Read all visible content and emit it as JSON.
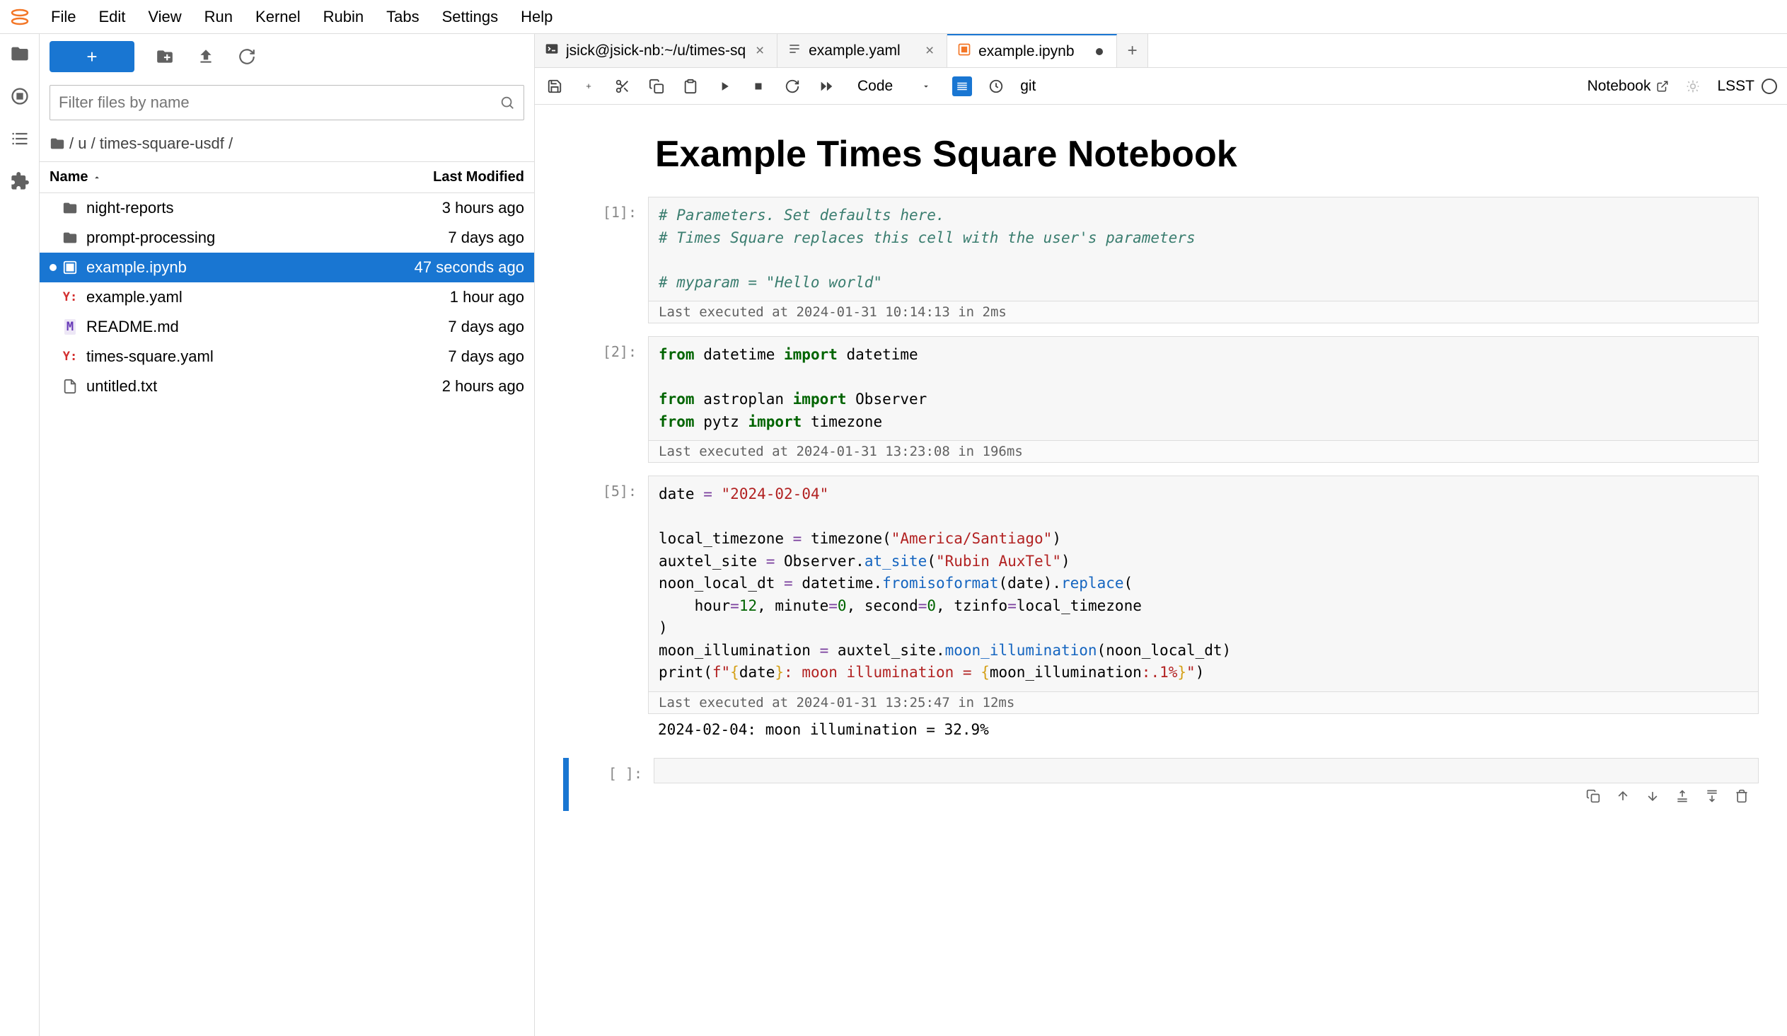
{
  "menu": [
    "File",
    "Edit",
    "View",
    "Run",
    "Kernel",
    "Rubin",
    "Tabs",
    "Settings",
    "Help"
  ],
  "filter_placeholder": "Filter files by name",
  "breadcrumb": "/ u / times-square-usdf /",
  "file_header": {
    "name": "Name",
    "modified": "Last Modified"
  },
  "files": [
    {
      "name": "night-reports",
      "type": "folder",
      "modified": "3 hours ago"
    },
    {
      "name": "prompt-processing",
      "type": "folder",
      "modified": "7 days ago"
    },
    {
      "name": "example.ipynb",
      "type": "notebook",
      "modified": "47 seconds ago",
      "selected": true,
      "dirty": true
    },
    {
      "name": "example.yaml",
      "type": "yaml",
      "modified": "1 hour ago"
    },
    {
      "name": "README.md",
      "type": "md",
      "modified": "7 days ago"
    },
    {
      "name": "times-square.yaml",
      "type": "yaml",
      "modified": "7 days ago"
    },
    {
      "name": "untitled.txt",
      "type": "file",
      "modified": "2 hours ago"
    }
  ],
  "tabs": [
    {
      "label": "jsick@jsick-nb:~/u/times-sq",
      "type": "terminal"
    },
    {
      "label": "example.yaml",
      "type": "editor"
    },
    {
      "label": "example.ipynb",
      "type": "notebook",
      "active": true,
      "dirty": true
    }
  ],
  "cell_type": "Code",
  "git_label": "git",
  "nb_mode": "Notebook",
  "kernel": "LSST",
  "notebook": {
    "title": "Example Times Square Notebook",
    "cells": [
      {
        "prompt": "[1]:",
        "exec": "Last executed at 2024-01-31 10:14:13 in 2ms",
        "lines": [
          "# Parameters. Set defaults here.",
          "# Times Square replaces this cell with the user's parameters",
          "",
          "# myparam = \"Hello world\""
        ]
      },
      {
        "prompt": "[2]:",
        "exec": "Last executed at 2024-01-31 13:23:08 in 196ms"
      },
      {
        "prompt": "[5]:",
        "exec": "Last executed at 2024-01-31 13:25:47 in 12ms",
        "output": "2024-02-04: moon illumination = 32.9%"
      },
      {
        "prompt": "[ ]:",
        "active": true
      }
    ]
  }
}
